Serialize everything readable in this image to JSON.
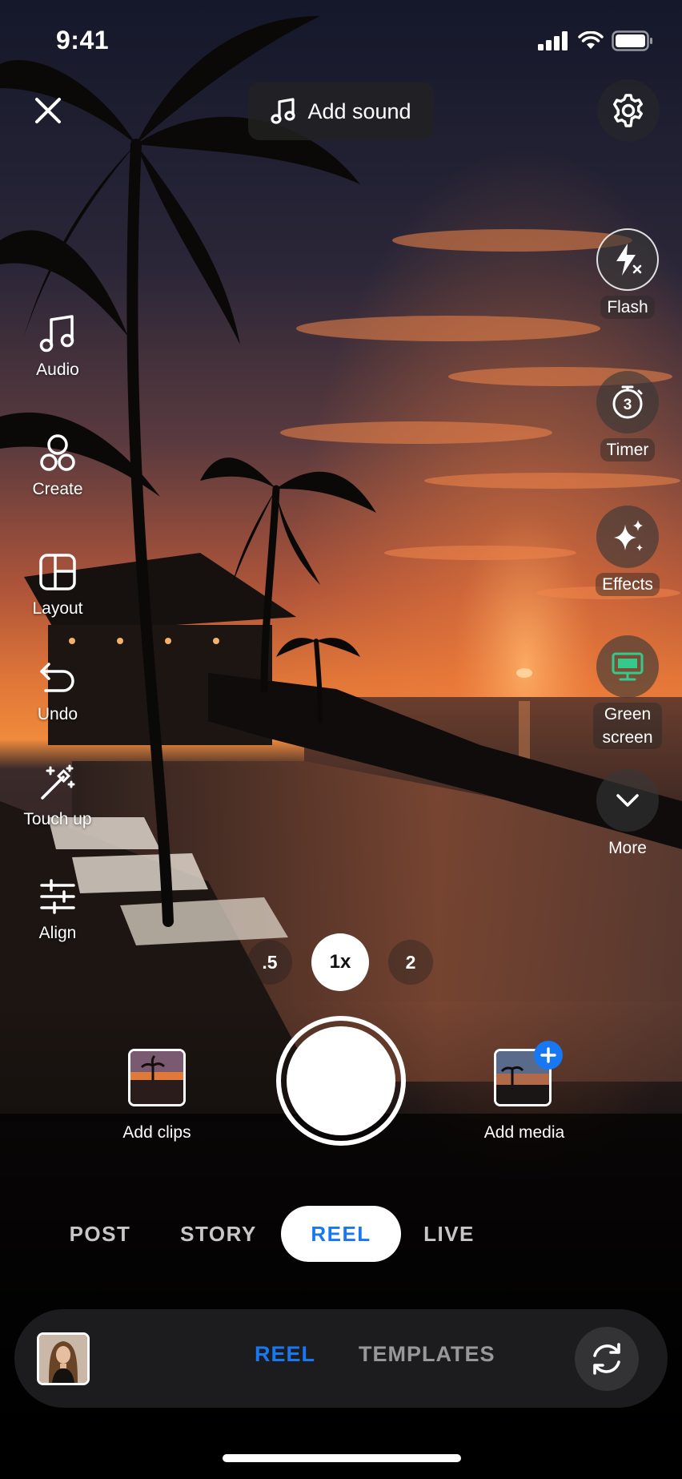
{
  "status_bar": {
    "time": "9:41"
  },
  "top": {
    "add_sound_label": "Add sound"
  },
  "left_tools": [
    {
      "label": "Audio",
      "icon": "music-note-icon"
    },
    {
      "label": "Create",
      "icon": "create-icon"
    },
    {
      "label": "Layout",
      "icon": "layout-icon"
    },
    {
      "label": "Undo",
      "icon": "undo-icon"
    },
    {
      "label": "Touch up",
      "icon": "magic-wand-icon"
    },
    {
      "label": "Align",
      "icon": "sliders-icon"
    }
  ],
  "right_tools": {
    "flash": "Flash",
    "timer": "Timer",
    "timer_value": "3",
    "effects": "Effects",
    "green_screen": "Green screen",
    "more": "More"
  },
  "zoom": {
    "options": [
      ".5",
      "1x",
      "2"
    ],
    "selected": "1x"
  },
  "capture": {
    "add_clips": "Add clips",
    "add_media": "Add media"
  },
  "modes": {
    "items": [
      "POST",
      "STORY",
      "REEL",
      "LIVE"
    ],
    "selected": "REEL"
  },
  "bottom_bar": {
    "tabs": [
      "REEL",
      "TEMPLATES"
    ],
    "selected": "REEL"
  },
  "colors": {
    "accent": "#1877f2",
    "green_screen_icon": "#35c98a"
  }
}
